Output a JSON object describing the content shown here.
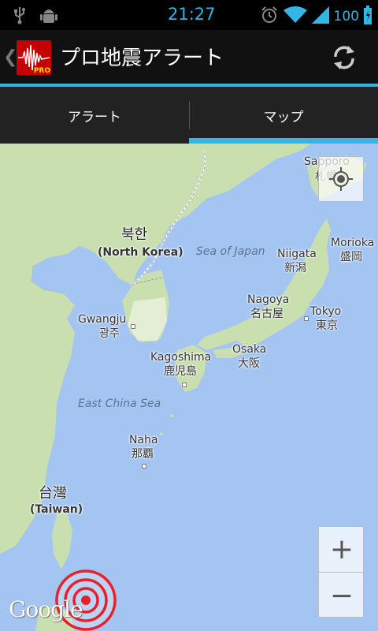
{
  "status_bar": {
    "time": "21:27",
    "battery": "100",
    "icons": [
      "usb-icon",
      "android-debug-icon",
      "alarm-icon",
      "wifi-icon",
      "signal-icon",
      "battery-icon"
    ]
  },
  "action_bar": {
    "title": "プロ地震アラート",
    "app_icon_badge": "PRO",
    "refresh_icon": "refresh-icon"
  },
  "tabs": [
    {
      "label": "アラート",
      "selected": false
    },
    {
      "label": "マップ",
      "selected": true
    }
  ],
  "map": {
    "labels": {
      "sapporo_en": "Sapporo",
      "sapporo_jp": "札幌",
      "north_korea_kr": "북한",
      "north_korea_en": "(North Korea)",
      "sea_of_japan": "Sea of Japan",
      "niigata_en": "Niigata",
      "niigata_jp": "新潟",
      "morioka_en": "Morioka",
      "morioka_jp": "盛岡",
      "gwangju_en": "Gwangju",
      "gwangju_kr": "광주",
      "nagoya_en": "Nagoya",
      "nagoya_jp": "名古屋",
      "tokyo_en": "Tokyo",
      "tokyo_jp": "東京",
      "kagoshima_en": "Kagoshima",
      "kagoshima_jp": "鹿児島",
      "osaka_en": "Osaka",
      "osaka_jp": "大阪",
      "east_china_sea": "East China Sea",
      "naha_en": "Naha",
      "naha_jp": "那覇",
      "taiwan_zh": "台灣",
      "taiwan_en": "(Taiwan)",
      "google": "Google"
    },
    "zoom_in": "+",
    "zoom_out": "−",
    "colors": {
      "sea": "#a4c5f2",
      "land": "#e9e5dc",
      "green": "#c9dfaf",
      "quake_ring": "#e8202a"
    }
  }
}
